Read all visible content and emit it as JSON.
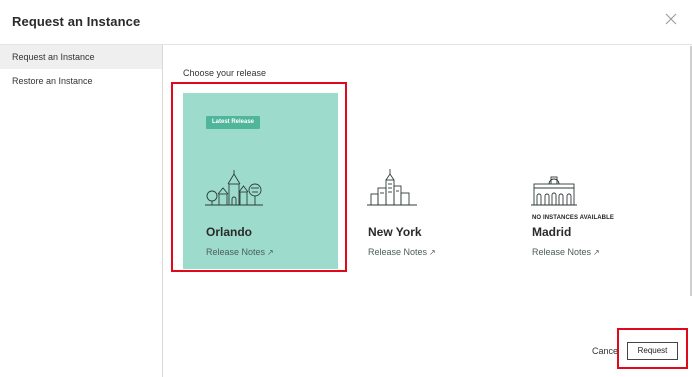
{
  "header": {
    "title": "Request an Instance"
  },
  "sidebar": {
    "items": [
      {
        "label": "Request an Instance",
        "active": true
      },
      {
        "label": "Restore an Instance",
        "active": false
      }
    ]
  },
  "main": {
    "section_label": "Choose your release",
    "releases": [
      {
        "name": "Orlando",
        "badge": "Latest Release",
        "notes_label": "Release Notes",
        "notes_icon": "external-link-arrow",
        "selected": true,
        "note": ""
      },
      {
        "name": "New York",
        "badge": "",
        "notes_label": "Release Notes",
        "notes_icon": "external-link-arrow",
        "selected": false,
        "note": ""
      },
      {
        "name": "Madrid",
        "badge": "",
        "notes_label": "Release Notes",
        "notes_icon": "external-link-arrow",
        "selected": false,
        "note": "NO INSTANCES AVAILABLE"
      }
    ]
  },
  "footer": {
    "cancel_label": "Cance",
    "request_label": "Request"
  },
  "colors": {
    "selected_card": "#9ddccd",
    "badge": "#4fb59b",
    "highlight": "#e0091c"
  }
}
